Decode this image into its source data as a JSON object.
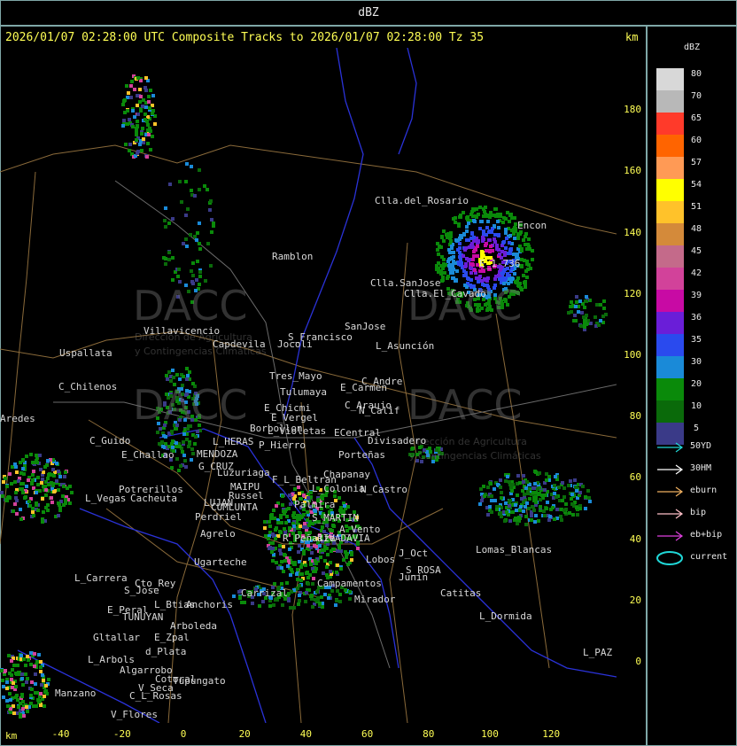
{
  "header": {
    "title": "dBZ"
  },
  "plot": {
    "title": "2026/01/07 02:28:00 UTC Composite Tracks to 2026/01/07 02:28:00 Tz 35",
    "unit_y": "km",
    "unit_x": "km",
    "y_ticks": [
      "180",
      "160",
      "140",
      "120",
      "100",
      "80",
      "60",
      "40",
      "20",
      "0"
    ],
    "x_ticks": [
      "-40",
      "-20",
      "0",
      "20",
      "40",
      "60",
      "80",
      "100",
      "120"
    ]
  },
  "watermark": {
    "brand": "DACC",
    "line1": "Dirección de Agricultura",
    "line2": "y Contingencias Climáticas"
  },
  "places": [
    "Clla.del_Rosario",
    "Encon",
    "E_1-736",
    "Ramblon",
    "Clla.SanJose",
    "Clla.El_Cavado",
    "Villavicencio",
    "Uspallata",
    "Capdevila",
    "S_Francisco",
    "Jocoli",
    "SanJose",
    "L_Asunción",
    "Tres_Mayo",
    "Tulumaya",
    "E_Carmen",
    "C_Andre",
    "C_Chilenos",
    "E_Chicmi",
    "E_Vergel",
    "C_Araujo",
    "N_Calif",
    "Borbollon",
    "L_Violetas",
    "ECentral",
    "Divisadero",
    "C_Guido",
    "L_HERAS",
    "P_Hierro",
    "E_Challao",
    "MENDOZA",
    "Porteñas",
    "G_CRUZ",
    "Luzuriaga",
    "Chapanay",
    "F_L_Beltran",
    "L_Colonia",
    "Potrerillos",
    "MAIPU",
    "Russel",
    "Palmira",
    "Cacheuta",
    "L_Vegas",
    "LUJAN",
    "CUMLUNTA",
    "N_Castro",
    "Perdriel",
    "S_MARTIN",
    "A_Vento",
    "Agrelo",
    "R_Peñaiza",
    "RIVADAVIA",
    "J_Oct",
    "Ugarteche",
    "S_ROSA",
    "L_Carrera",
    "Cto_Rey",
    "S_Jose",
    "Carrizal",
    "Lomas_Blancas",
    "Lobos",
    "Junín",
    "Campamentos",
    "Mirador",
    "Catitas",
    "E_Peral",
    "TUNUYAN",
    "L_Btias",
    "Anchoris",
    "L_Dormida",
    "Arboleda",
    "Gltallar",
    "E_Zpal",
    "d_Plata",
    "L_Arbols",
    "L_PAZ",
    "Algarrobo",
    "Tupungato",
    "Manzano",
    "Cotoral",
    "C_L_Rosas",
    "V_Seca",
    "V_Flores",
    "Aredes"
  ],
  "legend": {
    "title": "dBZ",
    "levels": [
      {
        "label": "80",
        "color": "#d8d8d8"
      },
      {
        "label": "70",
        "color": "#b8b8b8"
      },
      {
        "label": "65",
        "color": "#ff3a2a"
      },
      {
        "label": "60",
        "color": "#ff6400"
      },
      {
        "label": "57",
        "color": "#ff9a55"
      },
      {
        "label": "54",
        "color": "#ffff00"
      },
      {
        "label": "51",
        "color": "#ffc22a"
      },
      {
        "label": "48",
        "color": "#d48a3a"
      },
      {
        "label": "45",
        "color": "#c46a8a"
      },
      {
        "label": "42",
        "color": "#d2429a"
      },
      {
        "label": "39",
        "color": "#c80aa4"
      },
      {
        "label": "36",
        "color": "#6a1ed8"
      },
      {
        "label": "35",
        "color": "#2a4aee"
      },
      {
        "label": "30",
        "color": "#1a8ad8"
      },
      {
        "label": "20",
        "color": "#0a8a0a"
      },
      {
        "label": "10",
        "color": "#0a6a0a"
      },
      {
        "label": "5",
        "color": "#3a3a88"
      }
    ],
    "tracks": [
      {
        "label": "50YD",
        "color": "#20d8d8"
      },
      {
        "label": "30HM",
        "color": "#ffffff"
      },
      {
        "label": "eburn",
        "color": "#f0b060"
      },
      {
        "label": "bip",
        "color": "#ffc0c8"
      },
      {
        "label": "eb+bip",
        "color": "#e040e0"
      },
      {
        "label": "current",
        "color": "#20d8d8"
      }
    ]
  }
}
